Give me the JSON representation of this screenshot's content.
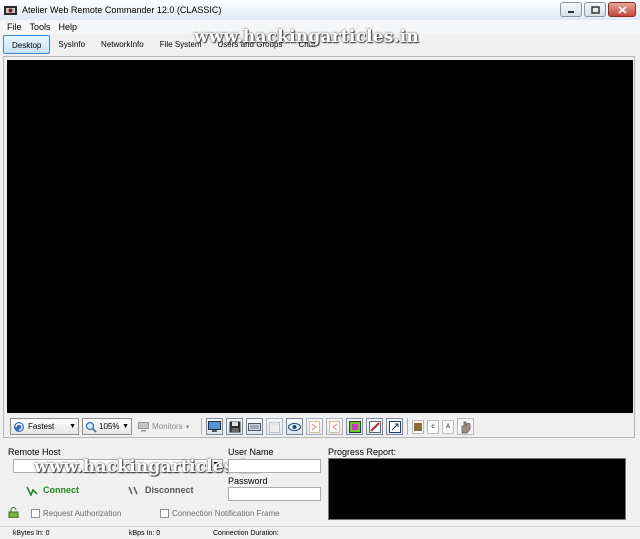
{
  "window": {
    "title": "Atelier Web Remote Commander 12.0 (CLASSIC)"
  },
  "menu": [
    "File",
    "Tools",
    "Help"
  ],
  "tabs": [
    "Desktop",
    "SysInfo",
    "NetworkInfo",
    "File System",
    "Users and Groups",
    "Chat"
  ],
  "active_tab": "Desktop",
  "watermark": "www.hackingarticles.in",
  "toolbar": {
    "speed_value": "Fastest",
    "zoom_value": "105%",
    "monitors_label": "Monitors",
    "icons": [
      "display-icon",
      "save-icon",
      "keyboard-icon",
      "clipboard-icon",
      "eye-icon",
      "page-right-icon",
      "page-left-icon",
      "color-icon",
      "edit-icon",
      "fullscreen-icon",
      "a-icon",
      "c-icon",
      "arrow-icon",
      "hand-icon"
    ],
    "small_letters": [
      "a",
      "c",
      "A"
    ]
  },
  "connection": {
    "remote_host_label": "Remote Host",
    "remote_host_value": "",
    "user_name_label": "User Name",
    "user_name_value": "",
    "password_label": "Password",
    "password_value": "",
    "progress_label": "Progress Report:",
    "connect_label": "Connect",
    "disconnect_label": "Disconnect",
    "request_auth_label": "Request Authorization",
    "notif_frame_label": "Connection Notification Frame"
  },
  "status": {
    "kbytes_in": "kBytes In:  0",
    "kbps_in": "kBps In:  0",
    "duration": "Connection Duration:"
  },
  "colors": {
    "accent": "#3c8bd0",
    "connect_green": "#1d8a1d",
    "screen": "#000000"
  }
}
